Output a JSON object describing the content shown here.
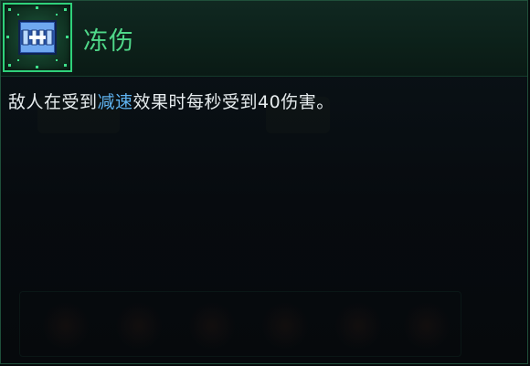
{
  "tooltip": {
    "title": "冻伤",
    "icon": "frost-chain-icon",
    "description": {
      "before": "敌人在受到",
      "highlight": "减速",
      "after": "效果时每秒受到40伤害。"
    }
  },
  "colors": {
    "title": "#4fd889",
    "highlight": "#5fb3f0",
    "text": "#e6ecee",
    "frame": "#2fd17a"
  }
}
